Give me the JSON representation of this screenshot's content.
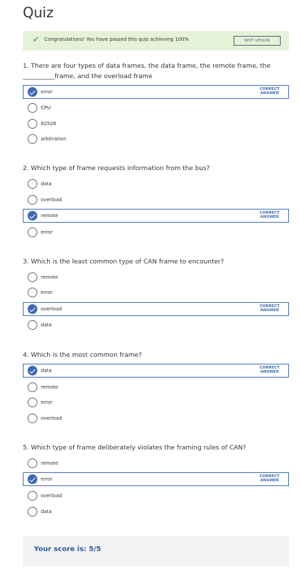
{
  "page": {
    "title": "Quiz"
  },
  "banner": {
    "icon": "checkmark-icon",
    "message": "Congratulations! You have passed this quiz achieving 100%",
    "next_label": "NEXT LESSON"
  },
  "questions": [
    {
      "text": "1. There are four types of data frames, the data frame, the remote frame, the __________frame, and the overload frame",
      "options": [
        "error",
        "CPU",
        "82526",
        "arbitration"
      ],
      "selected": 0,
      "correct_label": "CORRECT ANSWER"
    },
    {
      "text": "2. Which type of frame requests information from the bus?",
      "options": [
        "data",
        "overload",
        "remote",
        "error"
      ],
      "selected": 2,
      "correct_label": "CORRECT ANSWER"
    },
    {
      "text": "3. Which is the least common type of CAN frame to encounter?",
      "options": [
        "remote",
        "error",
        "overload",
        "data"
      ],
      "selected": 2,
      "correct_label": "CORRECT ANSWER"
    },
    {
      "text": "4. Which is the most common frame?",
      "options": [
        "data",
        "remote",
        "error",
        "overload"
      ],
      "selected": 0,
      "correct_label": "CORRECT ANSWER"
    },
    {
      "text": "5. Which type of frame deliberately violates the framing rules of CAN?",
      "options": [
        "remote",
        "error",
        "overload",
        "data"
      ],
      "selected": 1,
      "correct_label": "CORRECT ANSWER"
    }
  ],
  "score": {
    "text": "Your score is: 5/5"
  }
}
